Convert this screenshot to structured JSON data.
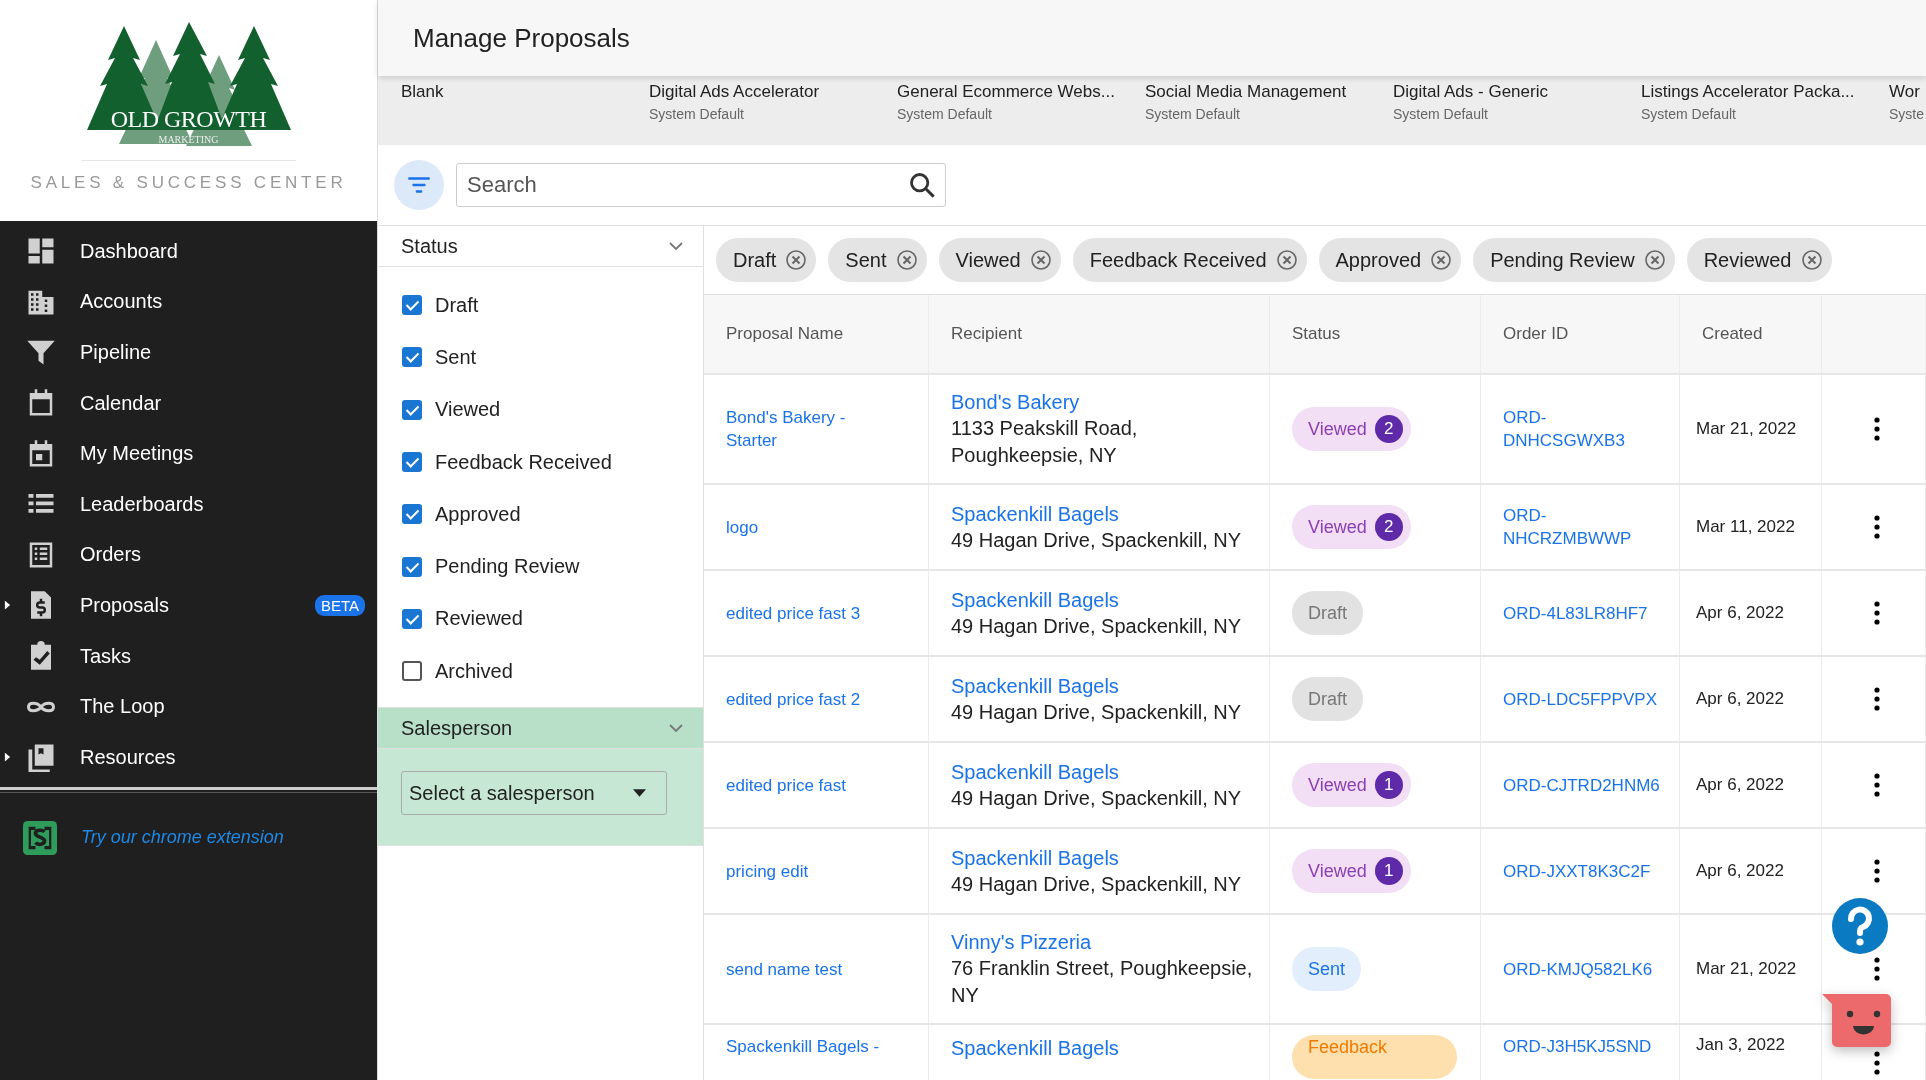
{
  "sidebar": {
    "logo": {
      "wordmark": "OLD GROWTH",
      "subtitle": "MARKETING"
    },
    "tagline": "SALES & SUCCESS CENTER",
    "items": [
      {
        "label": "Dashboard"
      },
      {
        "label": "Accounts"
      },
      {
        "label": "Pipeline"
      },
      {
        "label": "Calendar"
      },
      {
        "label": "My Meetings"
      },
      {
        "label": "Leaderboards"
      },
      {
        "label": "Orders"
      },
      {
        "label": "Proposals",
        "expanded": false,
        "badge": "BETA"
      },
      {
        "label": "Tasks"
      },
      {
        "label": "The Loop"
      },
      {
        "label": "Resources",
        "expanded": false
      }
    ],
    "extension_link": "Try our chrome extension"
  },
  "header": {
    "title": "Manage Proposals"
  },
  "templates": [
    {
      "name": "Blank"
    },
    {
      "name": "Digital Ads Accelerator",
      "subtitle": "System Default"
    },
    {
      "name": "General Ecommerce Webs...",
      "subtitle": "System Default"
    },
    {
      "name": "Social Media Management",
      "subtitle": "System Default"
    },
    {
      "name": "Digital Ads - Generic",
      "subtitle": "System Default"
    },
    {
      "name": "Listings Accelerator Packa...",
      "subtitle": "System Default"
    },
    {
      "name": "Wor",
      "subtitle": "Syste"
    }
  ],
  "search": {
    "placeholder": "Search"
  },
  "filters": {
    "sections": [
      {
        "title": "Status",
        "highlighted": false,
        "options": [
          {
            "label": "Draft",
            "checked": true
          },
          {
            "label": "Sent",
            "checked": true
          },
          {
            "label": "Viewed",
            "checked": true
          },
          {
            "label": "Feedback Received",
            "checked": true
          },
          {
            "label": "Approved",
            "checked": true
          },
          {
            "label": "Pending Review",
            "checked": true
          },
          {
            "label": "Reviewed",
            "checked": true
          },
          {
            "label": "Archived",
            "checked": false
          }
        ]
      },
      {
        "title": "Salesperson",
        "highlighted": true,
        "select_placeholder": "Select a salesperson"
      }
    ]
  },
  "chips": [
    "Draft",
    "Sent",
    "Viewed",
    "Feedback Received",
    "Approved",
    "Pending Review",
    "Reviewed"
  ],
  "table": {
    "columns": [
      "Proposal Name",
      "Recipient",
      "Status",
      "Order ID",
      "Created"
    ],
    "rows": [
      {
        "name": "Bond's Bakery - Starter",
        "recipient": "Bond's Bakery",
        "address": "1133 Peakskill Road, Poughkeepsie, NY",
        "status": {
          "kind": "viewed",
          "label": "Viewed",
          "count": "2"
        },
        "order_id": "ORD-DNHCSGWXB3",
        "created": "Mar 21, 2022"
      },
      {
        "name": "logo",
        "recipient": "Spackenkill Bagels",
        "address": "49 Hagan Drive, Spackenkill, NY",
        "status": {
          "kind": "viewed",
          "label": "Viewed",
          "count": "2"
        },
        "order_id": "ORD-NHCRZMBWWP",
        "created": "Mar 11, 2022"
      },
      {
        "name": "edited price fast 3",
        "recipient": "Spackenkill Bagels",
        "address": "49 Hagan Drive, Spackenkill, NY",
        "status": {
          "kind": "draft",
          "label": "Draft"
        },
        "order_id": "ORD-4L83LR8HF7",
        "created": "Apr 6, 2022"
      },
      {
        "name": "edited price fast 2",
        "recipient": "Spackenkill Bagels",
        "address": "49 Hagan Drive, Spackenkill, NY",
        "status": {
          "kind": "draft",
          "label": "Draft"
        },
        "order_id": "ORD-LDC5FPPVPX",
        "created": "Apr 6, 2022"
      },
      {
        "name": "edited price fast",
        "recipient": "Spackenkill Bagels",
        "address": "49 Hagan Drive, Spackenkill, NY",
        "status": {
          "kind": "viewed",
          "label": "Viewed",
          "count": "1"
        },
        "order_id": "ORD-CJTRD2HNM6",
        "created": "Apr 6, 2022"
      },
      {
        "name": "pricing edit",
        "recipient": "Spackenkill Bagels",
        "address": "49 Hagan Drive, Spackenkill, NY",
        "status": {
          "kind": "viewed",
          "label": "Viewed",
          "count": "1"
        },
        "order_id": "ORD-JXXT8K3C2F",
        "created": "Apr 6, 2022"
      },
      {
        "name": "send name test",
        "recipient": "Vinny's Pizzeria",
        "address": "76 Franklin Street, Poughkeepsie, NY",
        "status": {
          "kind": "sent",
          "label": "Sent"
        },
        "order_id": "ORD-KMJQ582LK6",
        "created": "Mar 21, 2022"
      },
      {
        "name": "Spackenkill Bagels -",
        "recipient": "Spackenkill Bagels",
        "status": {
          "kind": "feedback",
          "label": "Feedback"
        },
        "order_id": "ORD-J3H5KJ5SND",
        "created": "Jan 3, 2022"
      }
    ]
  }
}
